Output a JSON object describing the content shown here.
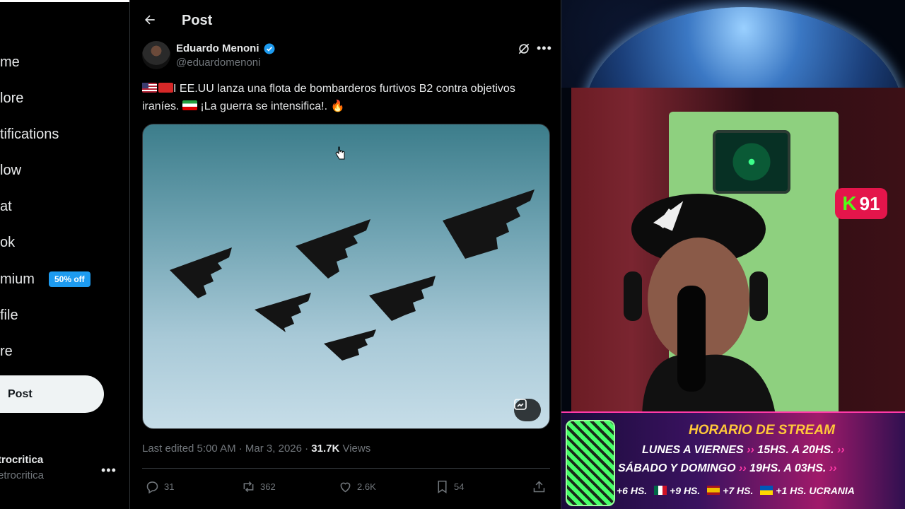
{
  "sidebar": {
    "items": [
      {
        "label": "Home",
        "visible": "me"
      },
      {
        "label": "Explore",
        "visible": "lore"
      },
      {
        "label": "Notifications",
        "visible": "tifications"
      },
      {
        "label": "Follow",
        "visible": "low"
      },
      {
        "label": "Chat",
        "visible": "at"
      },
      {
        "label": "Grok",
        "visible": "ok"
      },
      {
        "label": "Premium",
        "visible": "mium"
      },
      {
        "label": "Profile",
        "visible": "file"
      },
      {
        "label": "More",
        "visible": "re"
      }
    ],
    "premium_badge": "50% off",
    "post_button": "Post",
    "account": {
      "name": "trocritica",
      "handle": "etrocritica"
    }
  },
  "header": {
    "title": "Post"
  },
  "tweet": {
    "author_name": "Eduardo Menoni",
    "author_handle": "@eduardomenoni",
    "text_part1": "I EE.UU lanza una flota de bombarderos furtivos B2 contra objetivos iraníes.",
    "text_part2": "¡La guerra se intensifica!.",
    "fire_emoji": "🔥",
    "meta": {
      "edited": "Last edited 5:00 AM · Mar 3, 2026 · ",
      "views_count": "31.7K",
      "views_label": " Views"
    },
    "actions": {
      "replies": "31",
      "reposts": "362",
      "likes": "2.6K",
      "bookmarks": "54"
    }
  },
  "overlay": {
    "live_count": "91",
    "live_logo": "K",
    "schedule": {
      "title": "HORARIO DE STREAM",
      "row1_days": "LUNES A VIERNES",
      "row1_times": "15HS. A 20HS.",
      "row2_days": "SÁBADO Y DOMINGO",
      "row2_times": "19HS. A 03HS.",
      "tz1": "+6 HS.",
      "tz2": "+9 HS.",
      "tz3": "+7 HS.",
      "tz4": "+1 HS. UCRANIA"
    }
  },
  "colors": {
    "accent": "#1d9bf0",
    "background": "#000000",
    "muted_text": "#71767b",
    "live_badge": "#e4154b",
    "kick_green": "#53fc18"
  }
}
